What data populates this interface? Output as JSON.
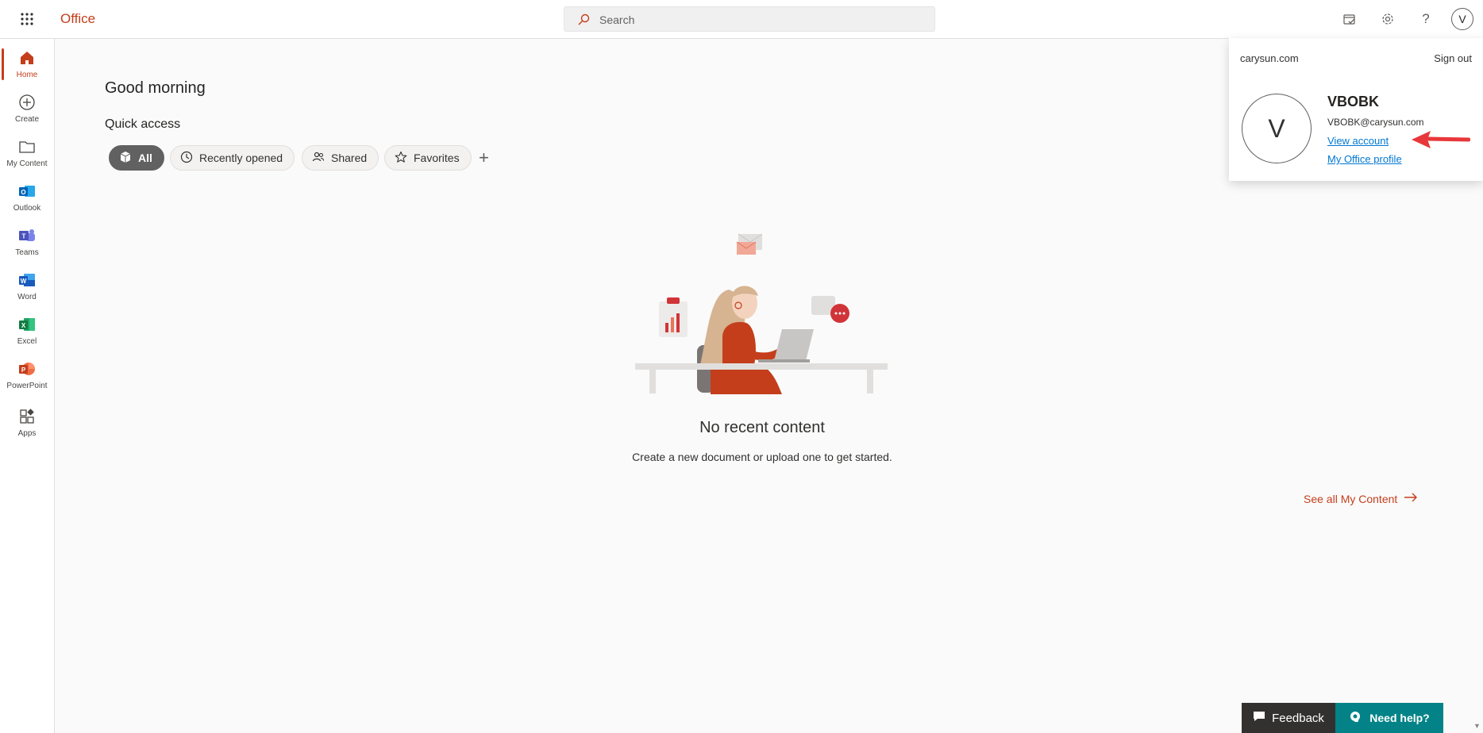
{
  "header": {
    "brand": "Office",
    "search_placeholder": "Search",
    "avatar_initial": "V"
  },
  "rail": {
    "items": [
      {
        "label": "Home",
        "icon": "home-icon"
      },
      {
        "label": "Create",
        "icon": "plus-circle-icon"
      },
      {
        "label": "My Content",
        "icon": "folder-icon"
      },
      {
        "label": "Outlook",
        "icon": "outlook-icon"
      },
      {
        "label": "Teams",
        "icon": "teams-icon"
      },
      {
        "label": "Word",
        "icon": "word-icon"
      },
      {
        "label": "Excel",
        "icon": "excel-icon"
      },
      {
        "label": "PowerPoint",
        "icon": "powerpoint-icon"
      },
      {
        "label": "Apps",
        "icon": "apps-icon"
      }
    ]
  },
  "main": {
    "greeting": "Good morning",
    "quick_access_title": "Quick access",
    "filters": [
      {
        "label": "All",
        "active": true
      },
      {
        "label": "Recently opened"
      },
      {
        "label": "Shared"
      },
      {
        "label": "Favorites"
      }
    ],
    "add_label": "+",
    "empty_title": "No recent content",
    "empty_subtitle": "Create a new document or upload one to get started.",
    "see_all": "See all My Content"
  },
  "account": {
    "tenant": "carysun.com",
    "sign_out": "Sign out",
    "initial": "V",
    "name": "VBOBK",
    "email": "VBOBK@carysun.com",
    "view_account": "View account",
    "office_profile": "My Office profile"
  },
  "footer": {
    "feedback": "Feedback",
    "need_help": "Need help?"
  },
  "colors": {
    "accent": "#c43e1c",
    "link": "#0078d4",
    "help": "#038387",
    "annotation_arrow": "#e8373a"
  }
}
